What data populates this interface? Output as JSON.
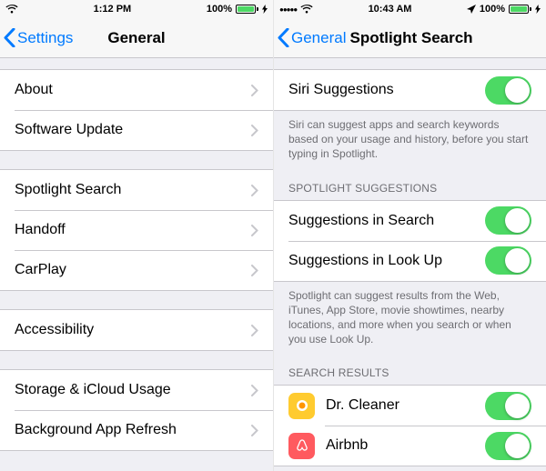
{
  "left": {
    "status": {
      "time": "1:12 PM",
      "battery": "100%"
    },
    "nav": {
      "back": "Settings",
      "title": "General"
    },
    "g1": [
      {
        "label": "About"
      },
      {
        "label": "Software Update"
      }
    ],
    "g2": [
      {
        "label": "Spotlight Search"
      },
      {
        "label": "Handoff"
      },
      {
        "label": "CarPlay"
      }
    ],
    "g3": [
      {
        "label": "Accessibility"
      }
    ],
    "g4": [
      {
        "label": "Storage & iCloud Usage"
      },
      {
        "label": "Background App Refresh"
      }
    ]
  },
  "right": {
    "status": {
      "time": "10:43 AM",
      "battery": "100%"
    },
    "nav": {
      "back": "General",
      "title": "Spotlight Search"
    },
    "g1": [
      {
        "label": "Siri Suggestions",
        "on": true
      }
    ],
    "g1_footer": "Siri can suggest apps and search keywords based on your usage and history, before you start typing in Spotlight.",
    "g2_header": "SPOTLIGHT SUGGESTIONS",
    "g2": [
      {
        "label": "Suggestions in Search",
        "on": true
      },
      {
        "label": "Suggestions in Look Up",
        "on": true
      }
    ],
    "g2_footer": "Spotlight can suggest results from the Web, iTunes, App Store, movie showtimes, nearby locations, and more when you search or when you use Look Up.",
    "g3_header": "SEARCH RESULTS",
    "g3": [
      {
        "label": "Dr. Cleaner",
        "on": true,
        "icon": "yellow"
      },
      {
        "label": "Airbnb",
        "on": true,
        "icon": "pink"
      }
    ]
  }
}
